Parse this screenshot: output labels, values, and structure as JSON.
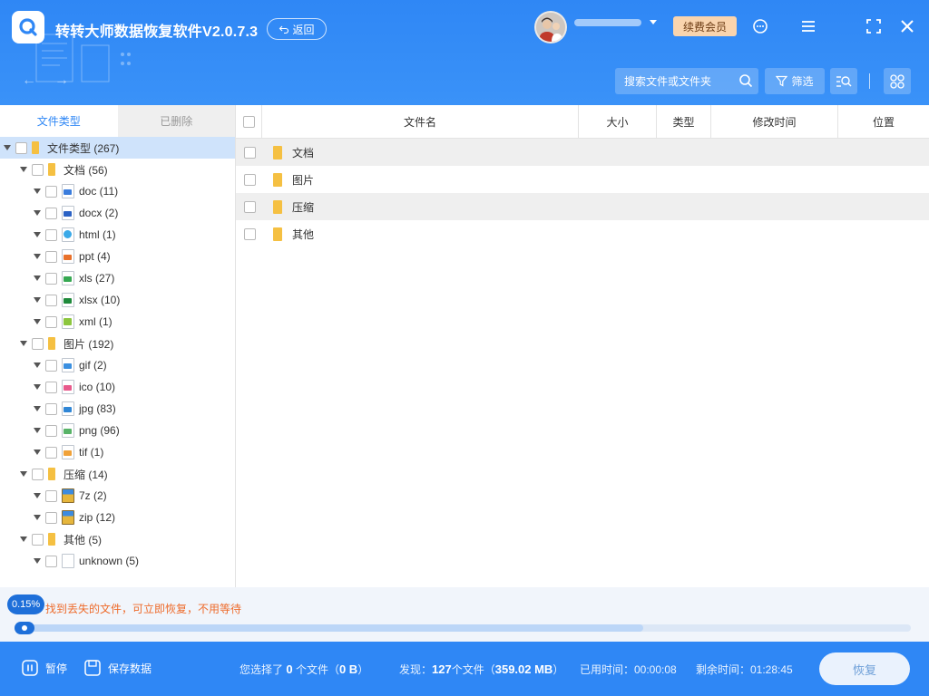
{
  "app": {
    "title": "转转大师数据恢复软件V2.0.7.3",
    "back_label": "返回"
  },
  "header": {
    "vip_label": "续费会员",
    "search_placeholder": "搜索文件或文件夹",
    "filter_label": "筛选"
  },
  "tree": {
    "tabs": [
      "文件类型",
      "已删除"
    ],
    "nodes": [
      {
        "label": "文件类型 (267)",
        "icon": "folder-icon"
      },
      {
        "label": "文档 (56)",
        "icon": "folder-icon"
      },
      {
        "label": "doc (11)",
        "icon": "doc-file-icon"
      },
      {
        "label": "docx (2)",
        "icon": "docx-file-icon"
      },
      {
        "label": "html (1)",
        "icon": "html-file-icon"
      },
      {
        "label": "ppt (4)",
        "icon": "ppt-file-icon"
      },
      {
        "label": "xls (27)",
        "icon": "xls-file-icon"
      },
      {
        "label": "xlsx (10)",
        "icon": "xlsx-file-icon"
      },
      {
        "label": "xml (1)",
        "icon": "xml-file-icon"
      },
      {
        "label": "图片 (192)",
        "icon": "folder-icon"
      },
      {
        "label": "gif (2)",
        "icon": "gif-file-icon"
      },
      {
        "label": "ico (10)",
        "icon": "ico-file-icon"
      },
      {
        "label": "jpg (83)",
        "icon": "jpg-file-icon"
      },
      {
        "label": "png (96)",
        "icon": "png-file-icon"
      },
      {
        "label": "tif (1)",
        "icon": "tif-file-icon"
      },
      {
        "label": "压缩 (14)",
        "icon": "folder-icon"
      },
      {
        "label": "7z (2)",
        "icon": "archive-7z-icon"
      },
      {
        "label": "zip (12)",
        "icon": "archive-zip-icon"
      },
      {
        "label": "其他 (5)",
        "icon": "folder-icon"
      },
      {
        "label": "unknown (5)",
        "icon": "unknown-file-icon"
      }
    ]
  },
  "list": {
    "columns": [
      "文件名",
      "大小",
      "类型",
      "修改时间",
      "位置"
    ],
    "rows": [
      {
        "name": "文档"
      },
      {
        "name": "图片"
      },
      {
        "name": "压缩"
      },
      {
        "name": "其他"
      }
    ]
  },
  "progress": {
    "percent_label": "0.15%",
    "message": "找到丢失的文件，可立即恢复，不用等待",
    "fraction": 0.7
  },
  "footer": {
    "pause_label": "暂停",
    "save_label": "保存数据",
    "selected_prefix": "您选择了",
    "selected_count": "0",
    "selected_mid": "个文件（",
    "selected_size": "0 B",
    "selected_suffix": "）",
    "found_prefix": "发现：",
    "found_count": "127",
    "found_mid": "个文件（",
    "found_size": "359.02 MB",
    "found_suffix": "）",
    "elapsed_label": "已用时间：00:00:08",
    "remaining_label": "剩余时间：01:28:45",
    "restore_label": "恢复"
  },
  "colors": {
    "accent": "#2f87f5",
    "folder": "#f5c042",
    "warning_text": "#ee6b2b",
    "vip_bg": "#f9d4ae"
  }
}
